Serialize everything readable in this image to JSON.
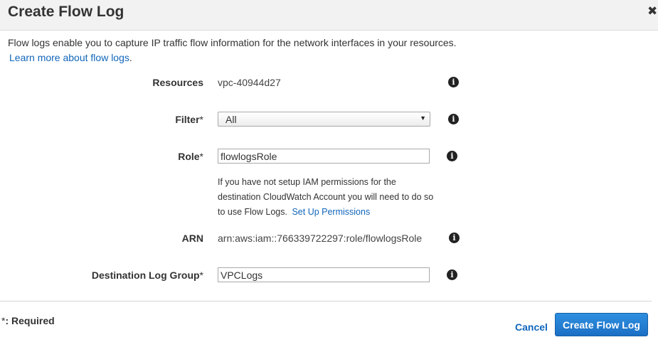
{
  "dialog": {
    "title": "Create Flow Log",
    "close_icon": "close-icon"
  },
  "intro": {
    "text": "Flow logs enable you to capture IP traffic flow information for the network interfaces in your resources.",
    "learn_more": "Learn more about flow logs",
    "learn_more_suffix": "."
  },
  "form": {
    "resources": {
      "label": "Resources",
      "value": "vpc-40944d27"
    },
    "filter": {
      "label": "Filter",
      "required_mark": "*",
      "value": "All"
    },
    "role": {
      "label": "Role",
      "required_mark": "*",
      "value": "flowlogsRole",
      "help_text": "If you have not setup IAM permissions for the destination CloudWatch Account you will need to do so to use Flow Logs.",
      "help_link": "Set Up Permissions"
    },
    "arn": {
      "label": "ARN",
      "value": "arn:aws:iam::766339722297:role/flowlogsRole"
    },
    "log_group": {
      "label": "Destination Log Group",
      "required_mark": "*",
      "value": "VPCLogs"
    },
    "info_glyph": "i",
    "select_caret": "▼"
  },
  "footer": {
    "required_mark": "*",
    "required_note": ": Required",
    "cancel": "Cancel",
    "submit": "Create Flow Log"
  }
}
